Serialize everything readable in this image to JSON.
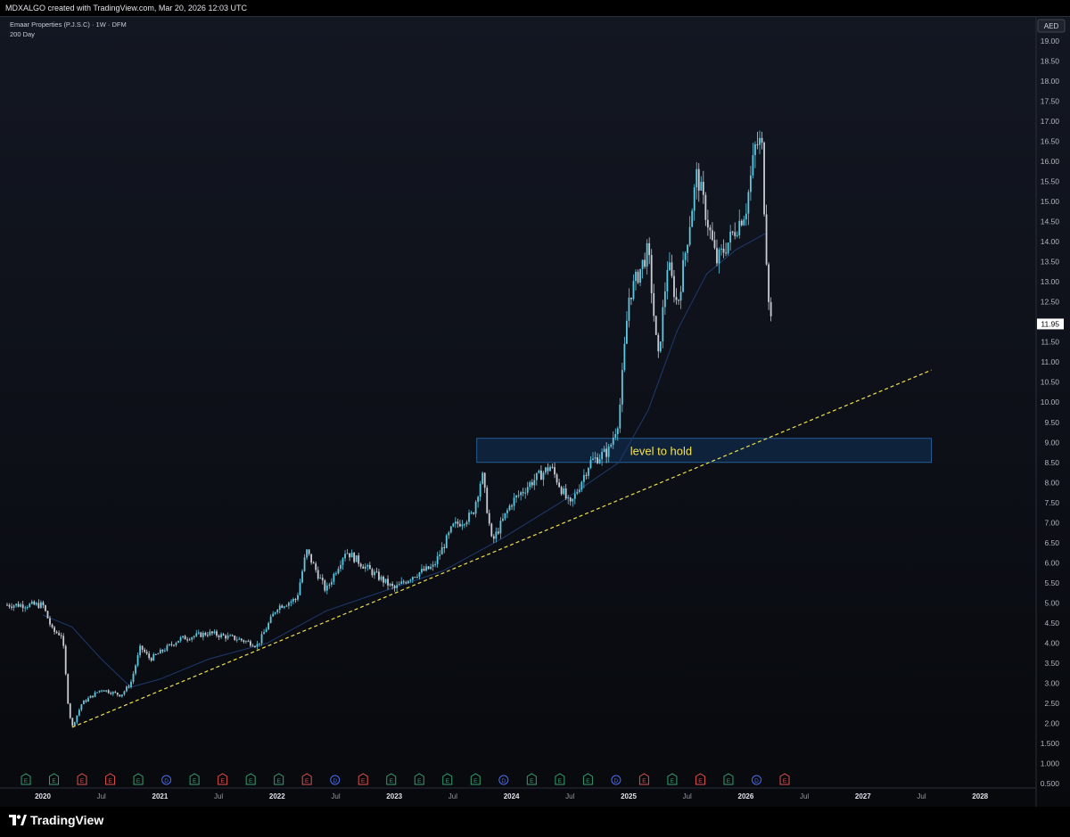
{
  "header": {
    "credit": "MDXALGO created with TradingView.com, Mar 20, 2026 12:03 UTC"
  },
  "legend": {
    "symbol_line": "Emaar Properties (P.J.S.C) · 1W · DFM",
    "indicator": "200 Day"
  },
  "currency": "AED",
  "last_price": "11.95",
  "annotation": "level to hold",
  "brand": "TradingView",
  "colors": {
    "bull": "#5ec8e0",
    "bear": "#c8ccd4",
    "ma": "#1e3a6e",
    "trendline": "#f0e04a",
    "zone_fill": "#0f2a48",
    "zone_border": "#2a6fb0"
  },
  "chart_data": {
    "type": "line",
    "title": "Emaar Properties (P.J.S.C) · 1W · DFM",
    "y_axis": {
      "scale": "log",
      "ticks": [
        "19.00",
        "18.50",
        "18.00",
        "17.50",
        "17.00",
        "16.50",
        "16.00",
        "15.50",
        "15.00",
        "14.50",
        "14.00",
        "13.50",
        "13.00",
        "12.50",
        "12.00",
        "11.50",
        "11.00",
        "10.50",
        "10.00",
        "9.50",
        "9.00",
        "8.50",
        "8.00",
        "7.50",
        "7.00",
        "6.50",
        "6.00",
        "5.50",
        "5.00",
        "4.50",
        "4.00",
        "3.50",
        "3.00",
        "2.50",
        "2.00",
        "1.500",
        "1.000",
        "0.500"
      ]
    },
    "x_axis": {
      "ticks": [
        {
          "label": "2020",
          "bold": true
        },
        {
          "label": "Jul",
          "bold": false
        },
        {
          "label": "2021",
          "bold": true
        },
        {
          "label": "Jul",
          "bold": false
        },
        {
          "label": "2022",
          "bold": true
        },
        {
          "label": "Jul",
          "bold": false
        },
        {
          "label": "2023",
          "bold": true
        },
        {
          "label": "Jul",
          "bold": false
        },
        {
          "label": "2024",
          "bold": true
        },
        {
          "label": "Jul",
          "bold": false
        },
        {
          "label": "2025",
          "bold": true
        },
        {
          "label": "Jul",
          "bold": false
        },
        {
          "label": "2026",
          "bold": true
        },
        {
          "label": "Jul",
          "bold": false
        },
        {
          "label": "2027",
          "bold": true
        },
        {
          "label": "Jul",
          "bold": false
        },
        {
          "label": "2028",
          "bold": true
        }
      ]
    },
    "series": [
      {
        "name": "Emaar Properties (P.J.S.C)",
        "points": [
          [
            "2020-01",
            4.95
          ],
          [
            "2020-02",
            4.3
          ],
          [
            "2020-03",
            4.2
          ],
          [
            "2020-03-20",
            2.4
          ],
          [
            "2020-04",
            1.9
          ],
          [
            "2020-05",
            2.5
          ],
          [
            "2020-07",
            2.85
          ],
          [
            "2020-09",
            2.7
          ],
          [
            "2020-10",
            3.0
          ],
          [
            "2020-11",
            3.9
          ],
          [
            "2020-12",
            3.6
          ],
          [
            "2021-03",
            4.1
          ],
          [
            "2021-06",
            4.25
          ],
          [
            "2021-09",
            4.1
          ],
          [
            "2021-11",
            3.95
          ],
          [
            "2022-01",
            4.9
          ],
          [
            "2022-03",
            5.1
          ],
          [
            "2022-04",
            6.3
          ],
          [
            "2022-06",
            5.3
          ],
          [
            "2022-08",
            6.3
          ],
          [
            "2022-10",
            5.9
          ],
          [
            "2023-01",
            5.35
          ],
          [
            "2023-03",
            5.7
          ],
          [
            "2023-05",
            5.9
          ],
          [
            "2023-07",
            6.9
          ],
          [
            "2023-09",
            7.2
          ],
          [
            "2023-10",
            8.2
          ],
          [
            "2023-11",
            6.5
          ],
          [
            "2024-01",
            7.5
          ],
          [
            "2024-03",
            8.0
          ],
          [
            "2024-05",
            8.4
          ],
          [
            "2024-07",
            7.4
          ],
          [
            "2024-09",
            8.5
          ],
          [
            "2024-11",
            8.8
          ],
          [
            "2024-12",
            9.6
          ],
          [
            "2025-01",
            12.6
          ],
          [
            "2025-03",
            13.8
          ],
          [
            "2025-04",
            11.0
          ],
          [
            "2025-05",
            13.5
          ],
          [
            "2025-06",
            12.4
          ],
          [
            "2025-08",
            15.7
          ],
          [
            "2025-10",
            13.5
          ],
          [
            "2025-11",
            13.9
          ],
          [
            "2026-01",
            14.8
          ],
          [
            "2026-02",
            16.4
          ],
          [
            "2026-02-20",
            16.5
          ],
          [
            "2026-03-01",
            14.2
          ],
          [
            "2026-03-10",
            12.8
          ],
          [
            "2026-03-20",
            11.95
          ]
        ]
      },
      {
        "name": "200 Day",
        "points": [
          [
            "2020-01",
            4.7
          ],
          [
            "2020-04",
            4.4
          ],
          [
            "2020-07",
            3.6
          ],
          [
            "2020-10",
            2.9
          ],
          [
            "2021-01",
            3.1
          ],
          [
            "2021-06",
            3.6
          ],
          [
            "2021-12",
            4.0
          ],
          [
            "2022-06",
            4.8
          ],
          [
            "2022-12",
            5.3
          ],
          [
            "2023-06",
            5.8
          ],
          [
            "2023-12",
            6.6
          ],
          [
            "2024-06",
            7.5
          ],
          [
            "2024-12",
            8.5
          ],
          [
            "2025-03",
            9.8
          ],
          [
            "2025-06",
            11.8
          ],
          [
            "2025-09",
            13.2
          ],
          [
            "2025-12",
            13.8
          ],
          [
            "2026-03",
            14.2
          ]
        ]
      }
    ],
    "trendline": {
      "from": [
        "2020-04",
        1.9
      ],
      "to": [
        "2027-08",
        10.8
      ]
    },
    "zone": {
      "label": "level to hold",
      "y_low": 8.5,
      "y_high": 9.1,
      "x_from": "2023-10",
      "x_to": "2027-08"
    },
    "event_markers": [
      "E",
      "E",
      "E",
      "E",
      "E",
      "D",
      "E",
      "E",
      "E",
      "E",
      "E",
      "D",
      "E",
      "E",
      "E",
      "E",
      "E",
      "D",
      "E",
      "E",
      "E",
      "D",
      "E",
      "E",
      "E",
      "E",
      "D",
      "E"
    ],
    "legend_placement": "top-left",
    "grid": false
  }
}
